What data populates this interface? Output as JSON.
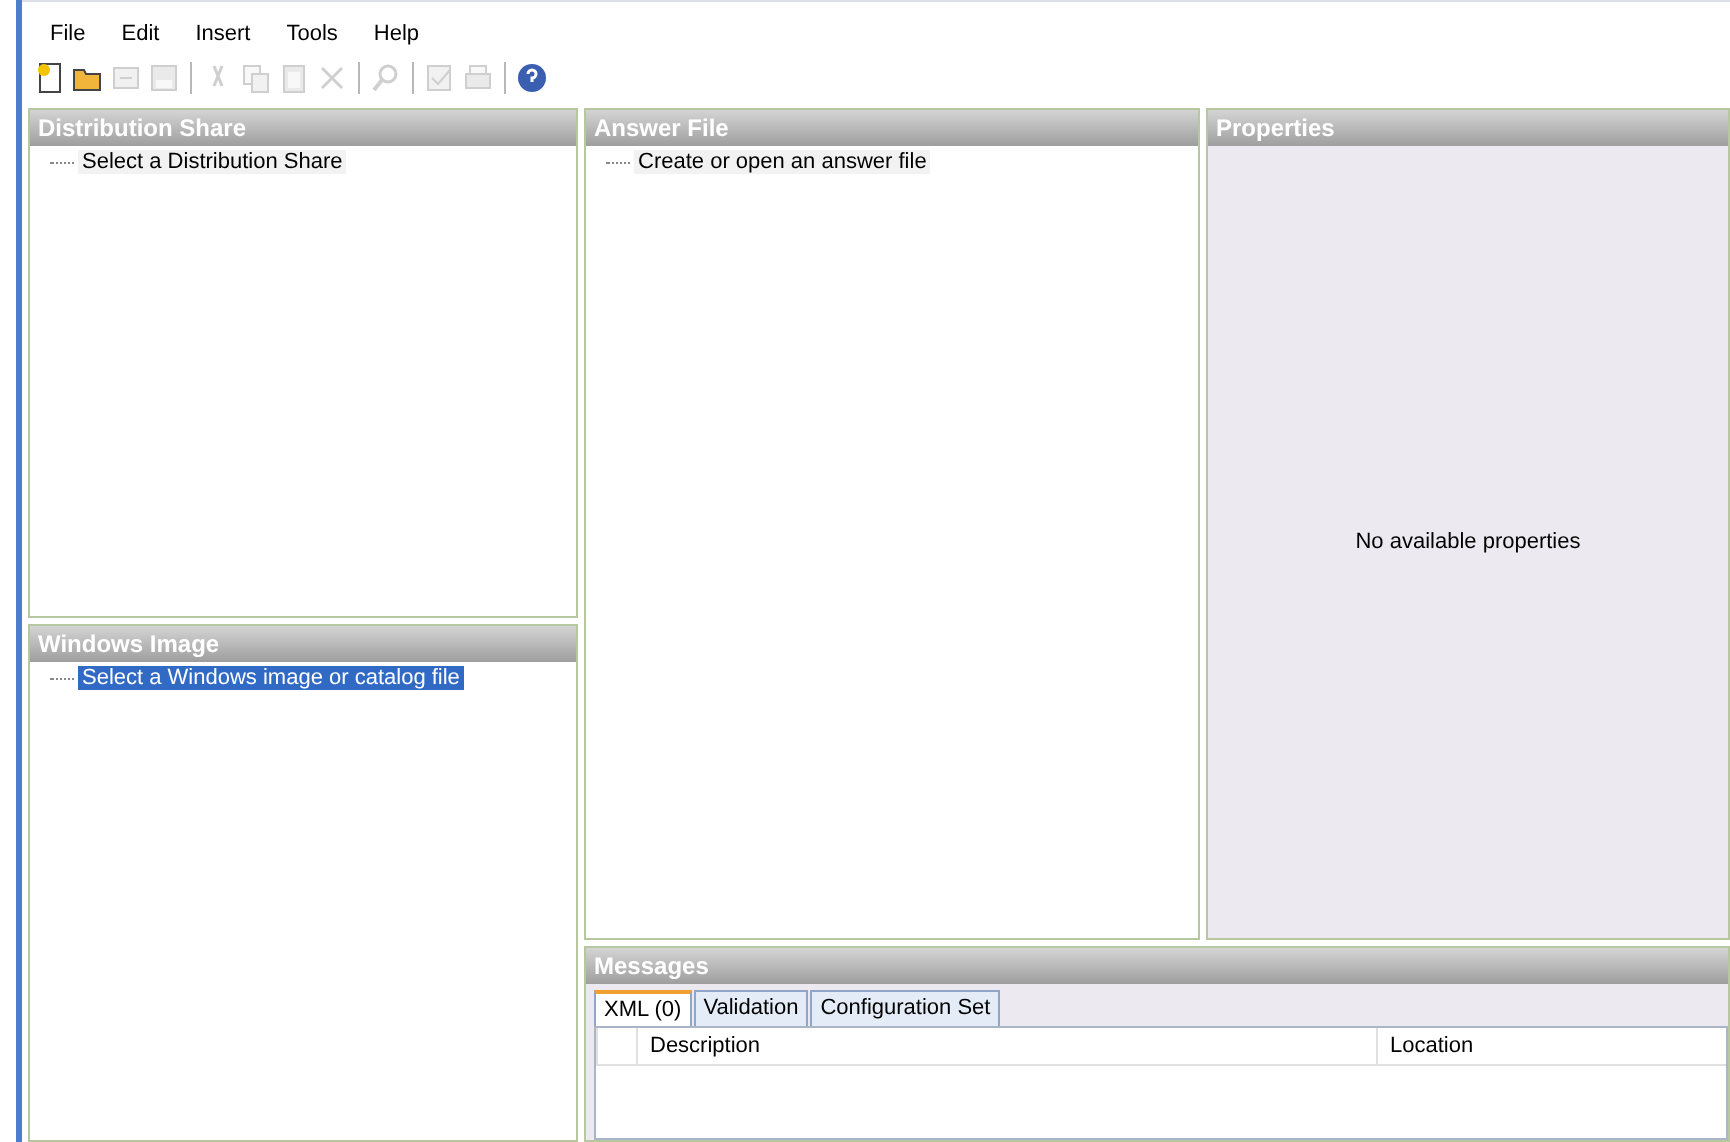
{
  "menu": [
    "File",
    "Edit",
    "Insert",
    "Tools",
    "Help"
  ],
  "toolbar": [
    {
      "kind": "new",
      "disabled": false
    },
    {
      "kind": "open",
      "disabled": false
    },
    {
      "kind": "close",
      "disabled": true
    },
    {
      "kind": "save",
      "disabled": true
    },
    {
      "kind": "sep"
    },
    {
      "kind": "cut",
      "disabled": true
    },
    {
      "kind": "copy",
      "disabled": true
    },
    {
      "kind": "paste",
      "disabled": true
    },
    {
      "kind": "delete",
      "disabled": true
    },
    {
      "kind": "sep"
    },
    {
      "kind": "find",
      "disabled": true
    },
    {
      "kind": "sep"
    },
    {
      "kind": "validate",
      "disabled": true
    },
    {
      "kind": "print",
      "disabled": true
    },
    {
      "kind": "sep"
    },
    {
      "kind": "help",
      "disabled": false
    }
  ],
  "distribution_share": {
    "title": "Distribution Share",
    "items": [
      {
        "label": "Select a Distribution Share",
        "selected": false
      }
    ]
  },
  "windows_image": {
    "title": "Windows Image",
    "items": [
      {
        "label": "Select a Windows image or catalog file",
        "selected": true
      }
    ]
  },
  "answer_file": {
    "title": "Answer File",
    "items": [
      {
        "label": "Create or open an answer file",
        "selected": false
      }
    ]
  },
  "properties": {
    "title": "Properties",
    "empty_text": "No available properties"
  },
  "messages": {
    "title": "Messages",
    "tabs": [
      {
        "label": "XML (0)",
        "selected": true
      },
      {
        "label": "Validation",
        "selected": false
      },
      {
        "label": "Configuration Set",
        "selected": false
      }
    ],
    "columns": [
      "Description",
      "Location"
    ]
  }
}
